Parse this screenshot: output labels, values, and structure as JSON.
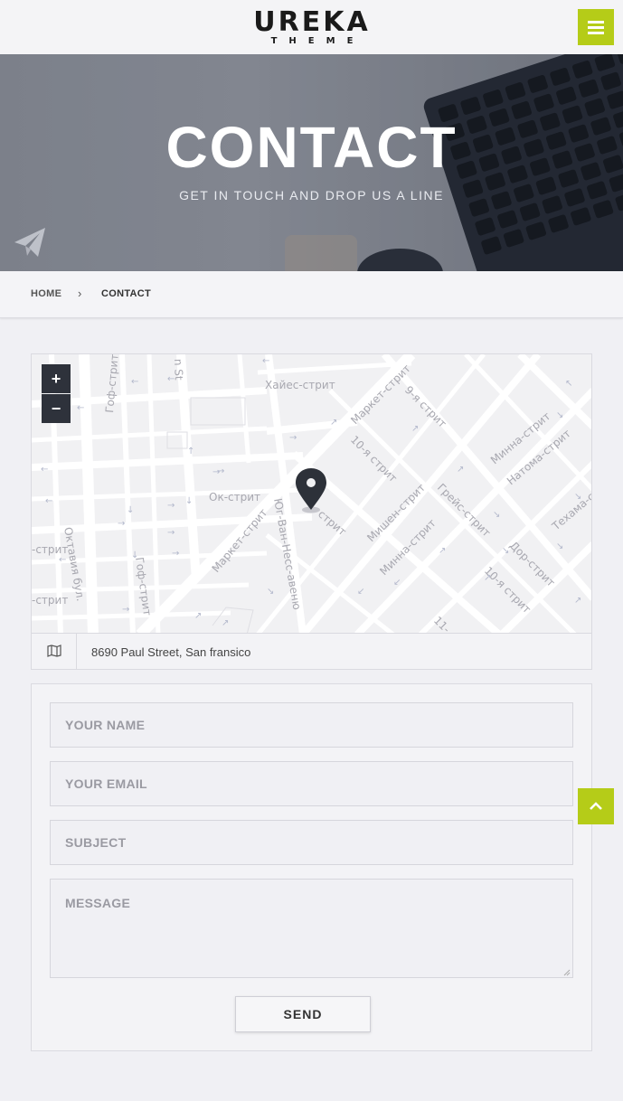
{
  "header": {
    "logo_main": "UREKA",
    "logo_sub": "THEME",
    "menu_icon": "hamburger-icon"
  },
  "hero": {
    "title": "CONTACT",
    "subtitle": "GET IN TOUCH AND DROP US A LINE",
    "icon": "paper-plane-icon"
  },
  "breadcrumb": {
    "home": "HOME",
    "separator": "›",
    "current": "CONTACT"
  },
  "map": {
    "zoom_in": "+",
    "zoom_out": "−",
    "streets": [
      "Хайес-стрит",
      "Маркет-стрит",
      "9-я стрит",
      "Гоф-стрит",
      "Минна-стрит",
      "10-я стрит",
      "Натома-стрит",
      "Ок-стрит",
      "Грейс-стрит",
      "Техама-с",
      "Мишен-стрит",
      "Юг-Ван-Несс-авеню",
      "Маркет-стрит",
      "Октавия бул.",
      "Гоф-стрит",
      "Минна-стрит",
      "Дор-стрит",
      "10-я стрит",
      "стрит",
      "-стрит",
      "-стрит",
      "11-",
      "n St",
      "стрит"
    ],
    "pin_icon": "map-pin-icon"
  },
  "address": {
    "icon": "map-icon",
    "text": "8690 Paul Street, San fransico"
  },
  "form": {
    "name_placeholder": "YOUR NAME",
    "email_placeholder": "YOUR EMAIL",
    "subject_placeholder": "SUBJECT",
    "message_placeholder": "MESSAGE",
    "send_label": "SEND"
  },
  "scroll_top_icon": "chevron-up-icon",
  "colors": {
    "accent": "#b5cc18",
    "dark": "#2e323b"
  }
}
